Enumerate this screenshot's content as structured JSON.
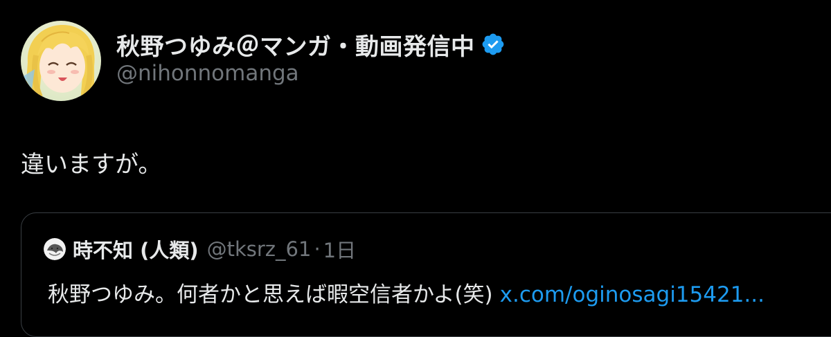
{
  "author": {
    "display_name": "秋野つゆみ＠マンガ・動画発信中",
    "handle": "@nihonnomanga",
    "verified": true,
    "avatar_icon": "anime-girl-avatar-icon"
  },
  "tweet": {
    "text": "違いますが。"
  },
  "quoted_tweet": {
    "display_name": "時不知 (人類)",
    "handle": "@tksrz_61",
    "separator": "·",
    "time": "1日",
    "text": "秋野つゆみ。何者かと思えば暇空信者かよ(笑)",
    "link_text": "x.com/oginosagi15421..."
  },
  "colors": {
    "background": "#000000",
    "primary_text": "#e7e9ea",
    "secondary_text": "#71767b",
    "link": "#1d9bf0",
    "verified_badge": "#1d9bf0",
    "quote_border": "#3a3f44"
  }
}
